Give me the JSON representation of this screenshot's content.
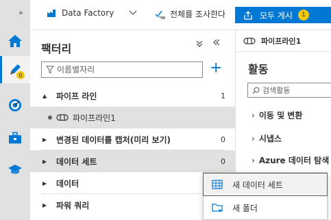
{
  "rail": {
    "expand_label": "»",
    "items": [
      {
        "name": "home",
        "icon": "home-icon"
      },
      {
        "name": "author",
        "icon": "pencil-icon",
        "badge": "0"
      },
      {
        "name": "monitor",
        "icon": "gauge-icon"
      },
      {
        "name": "manage",
        "icon": "toolbox-icon"
      },
      {
        "name": "learning",
        "icon": "graduation-cap-icon"
      }
    ]
  },
  "topbar": {
    "factory_name": "Data Factory",
    "validate_label": "전체를 조사한다",
    "publish_label": "모두 게시",
    "publish_count": "1"
  },
  "factory": {
    "title": "팩터리",
    "filter_placeholder": "이름별자리",
    "tree": [
      {
        "label": "파이프 라인",
        "count": "1",
        "expanded": true,
        "children": [
          {
            "label": "파이프라인1"
          }
        ]
      },
      {
        "label": "변경된 데이터를 캡처(미리 보기)",
        "count": "0"
      },
      {
        "label": "데이터 세트",
        "count": "0"
      },
      {
        "label": "데이터",
        "count": ""
      },
      {
        "label": "파워 쿼리",
        "count": ""
      }
    ]
  },
  "pipeline_tab": {
    "title": "파이프라인1"
  },
  "activities": {
    "title": "활동",
    "search_placeholder": "검색활동",
    "items": [
      "이동 및 변환",
      "시냅스",
      "Azure 데이터 탐색"
    ]
  },
  "context_menu": {
    "items": [
      {
        "label": "새 데이터 세트",
        "icon": "table-icon"
      },
      {
        "label": "새 폴더",
        "icon": "folder-add-icon"
      }
    ]
  },
  "colors": {
    "accent": "#0078d4",
    "badge": "#f2c811",
    "rail_bg": "#e1e1e1",
    "selected_bg": "#e1e1e1"
  }
}
